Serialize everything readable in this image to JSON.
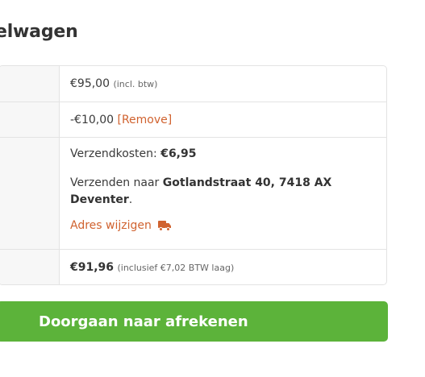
{
  "cart": {
    "heading": "elwagen"
  },
  "totals": {
    "subtotal_value": "€95,00",
    "subtotal_note": "(incl. btw)",
    "discount_value": "-€10,00",
    "discount_remove": "[Remove]",
    "shipping_label": "Verzendkosten: ",
    "shipping_value": "€6,95",
    "ship_to_prefix": "Verzenden naar ",
    "ship_to_address": "Gotlandstraat 40, 7418 AX Deventer",
    "ship_to_suffix": ".",
    "change_address": "Adres wijzigen",
    "total_value": "€91,96",
    "total_note": "(inclusief €7,02 BTW laag)"
  },
  "actions": {
    "checkout_label": "Doorgaan naar afrekenen"
  },
  "colors": {
    "accent_green": "#5cb33a",
    "link_orange": "#d0622f"
  },
  "icons": {
    "change_address_icon": "truck-icon"
  }
}
